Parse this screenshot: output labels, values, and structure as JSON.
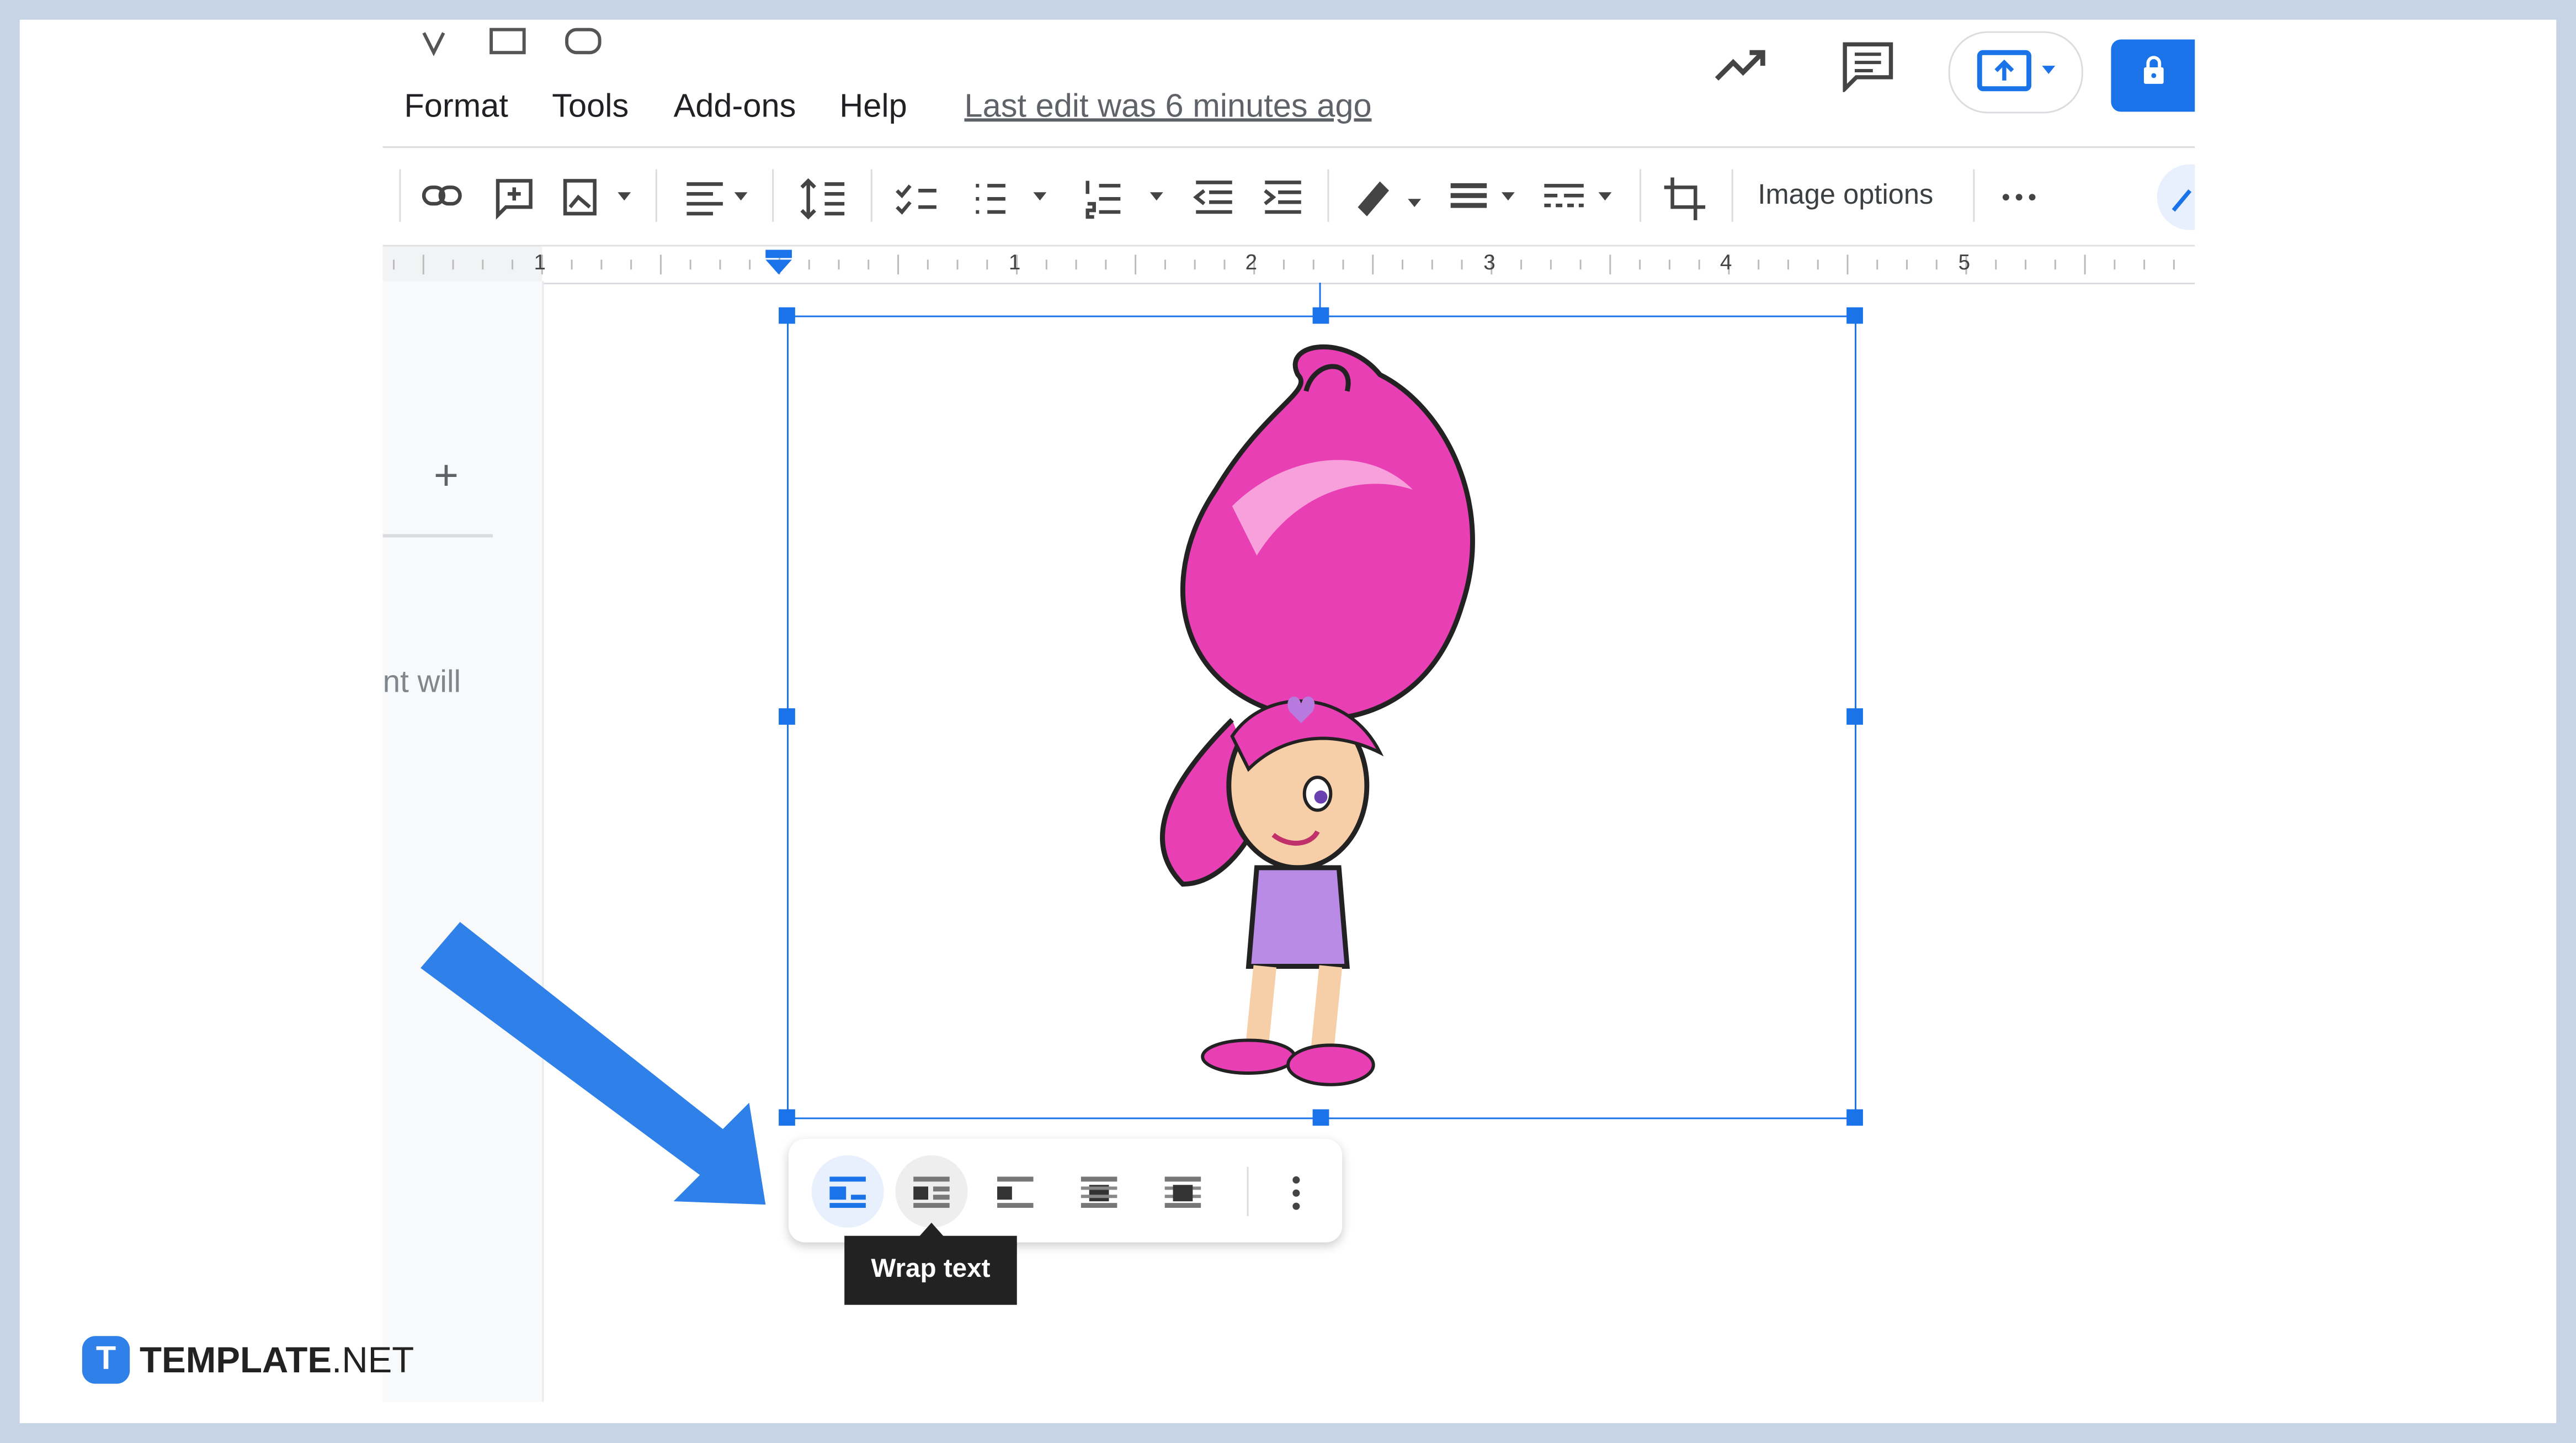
{
  "menu": {
    "items": [
      "Format",
      "Tools",
      "Add-ons",
      "Help"
    ],
    "last_edit": "Last edit was 6 minutes ago"
  },
  "toolbar": {
    "image_options": "Image options",
    "more": "⋯"
  },
  "ruler": {
    "labels": [
      "1",
      "1",
      "2",
      "3",
      "4",
      "5"
    ]
  },
  "sidebar": {
    "add": "+",
    "snippet": "nt will"
  },
  "image_toolbar": {
    "tooltip": "Wrap text",
    "selected_index": 0
  },
  "logo": {
    "brand": "TEMPLATE",
    "suffix": ".NET",
    "mark": "T"
  },
  "colors": {
    "accent": "#1a73e8",
    "arrow": "#2f80e8",
    "background": "#c7d4e6"
  }
}
